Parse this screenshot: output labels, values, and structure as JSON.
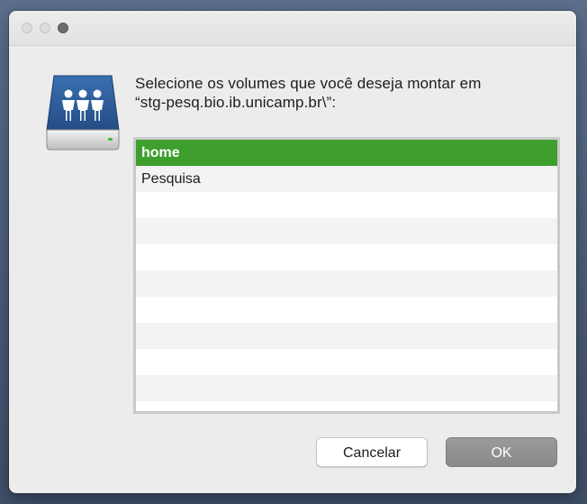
{
  "window": {
    "traffic_lights": [
      "close",
      "minimize",
      "zoom"
    ]
  },
  "dialog": {
    "icon": "shared-server-icon",
    "prompt_line1": "Selecione os volumes que você deseja montar em",
    "prompt_line2": "“stg-pesq.bio.ib.unicamp.br\\”:",
    "volumes": [
      {
        "label": "home",
        "selected": true
      },
      {
        "label": "Pesquisa",
        "selected": false
      }
    ],
    "empty_rows": 8,
    "cancel_label": "Cancelar",
    "ok_label": "OK"
  },
  "colors": {
    "selection": "#3e9e2e",
    "ok_button": "#8f8f8f",
    "server_icon": "#2d5e9c"
  }
}
